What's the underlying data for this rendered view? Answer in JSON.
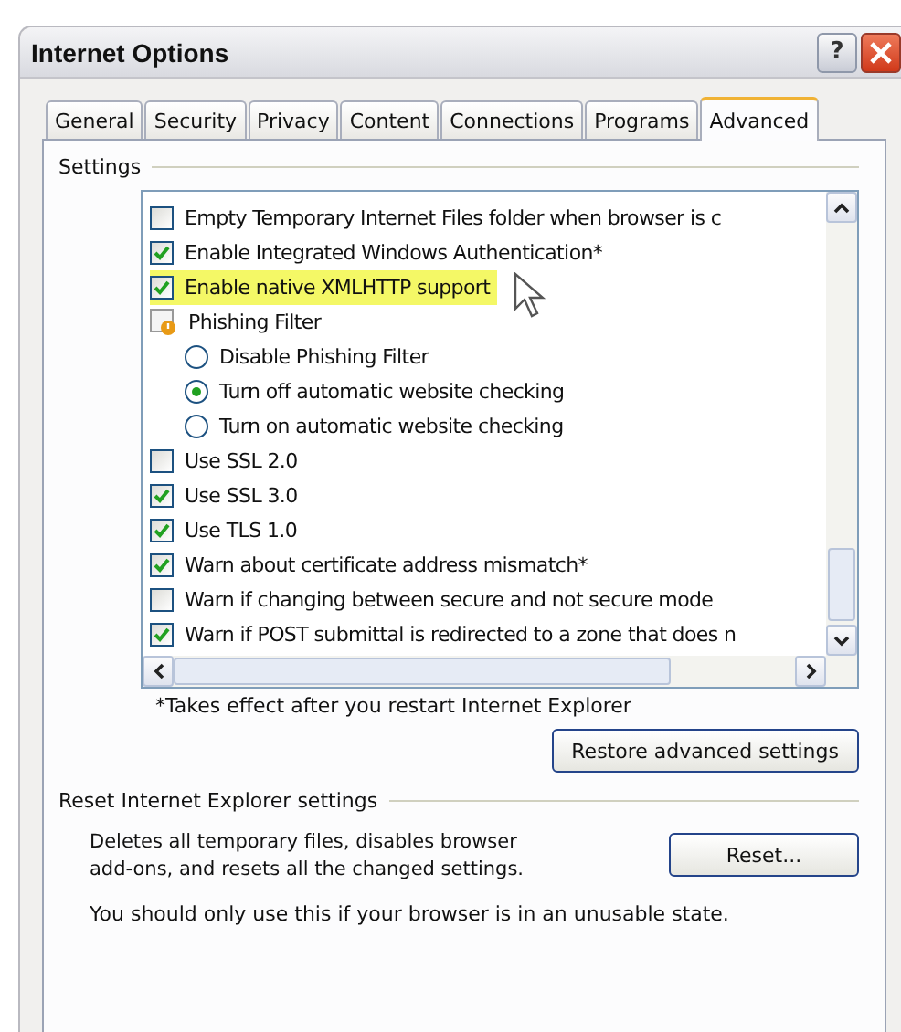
{
  "window": {
    "title": "Internet Options",
    "help_button": "?"
  },
  "tabs": [
    {
      "label": "General",
      "selected": false
    },
    {
      "label": "Security",
      "selected": false
    },
    {
      "label": "Privacy",
      "selected": false
    },
    {
      "label": "Content",
      "selected": false
    },
    {
      "label": "Connections",
      "selected": false
    },
    {
      "label": "Programs",
      "selected": false
    },
    {
      "label": "Advanced",
      "selected": true
    }
  ],
  "settings": {
    "title": "Settings",
    "items": [
      {
        "kind": "checkbox",
        "label": "Empty Temporary Internet Files folder when browser is c",
        "checked": false,
        "highlighted": false
      },
      {
        "kind": "checkbox",
        "label": "Enable Integrated Windows Authentication*",
        "checked": true,
        "highlighted": false
      },
      {
        "kind": "checkbox",
        "label": "Enable native XMLHTTP support",
        "checked": true,
        "highlighted": true
      },
      {
        "kind": "group",
        "label": "Phishing Filter"
      },
      {
        "kind": "radio",
        "label": "Disable Phishing Filter",
        "selected": false
      },
      {
        "kind": "radio",
        "label": "Turn off automatic website checking",
        "selected": true
      },
      {
        "kind": "radio",
        "label": "Turn on automatic website checking",
        "selected": false
      },
      {
        "kind": "checkbox",
        "label": "Use SSL 2.0",
        "checked": false,
        "highlighted": false
      },
      {
        "kind": "checkbox",
        "label": "Use SSL 3.0",
        "checked": true,
        "highlighted": false
      },
      {
        "kind": "checkbox",
        "label": "Use TLS 1.0",
        "checked": true,
        "highlighted": false
      },
      {
        "kind": "checkbox",
        "label": "Warn about certificate address mismatch*",
        "checked": true,
        "highlighted": false
      },
      {
        "kind": "checkbox",
        "label": "Warn if changing between secure and not secure mode",
        "checked": false,
        "highlighted": false
      },
      {
        "kind": "checkbox",
        "label": "Warn if POST submittal is redirected to a zone that does n",
        "checked": true,
        "highlighted": false
      }
    ],
    "note": "*Takes effect after you restart Internet Explorer",
    "restore_button": "Restore advanced settings"
  },
  "reset": {
    "title": "Reset Internet Explorer settings",
    "description": "Deletes all temporary files, disables browser add-ons, and resets all the changed settings.",
    "button": "Reset...",
    "warning": "You should only use this if your browser is in an unusable state."
  }
}
